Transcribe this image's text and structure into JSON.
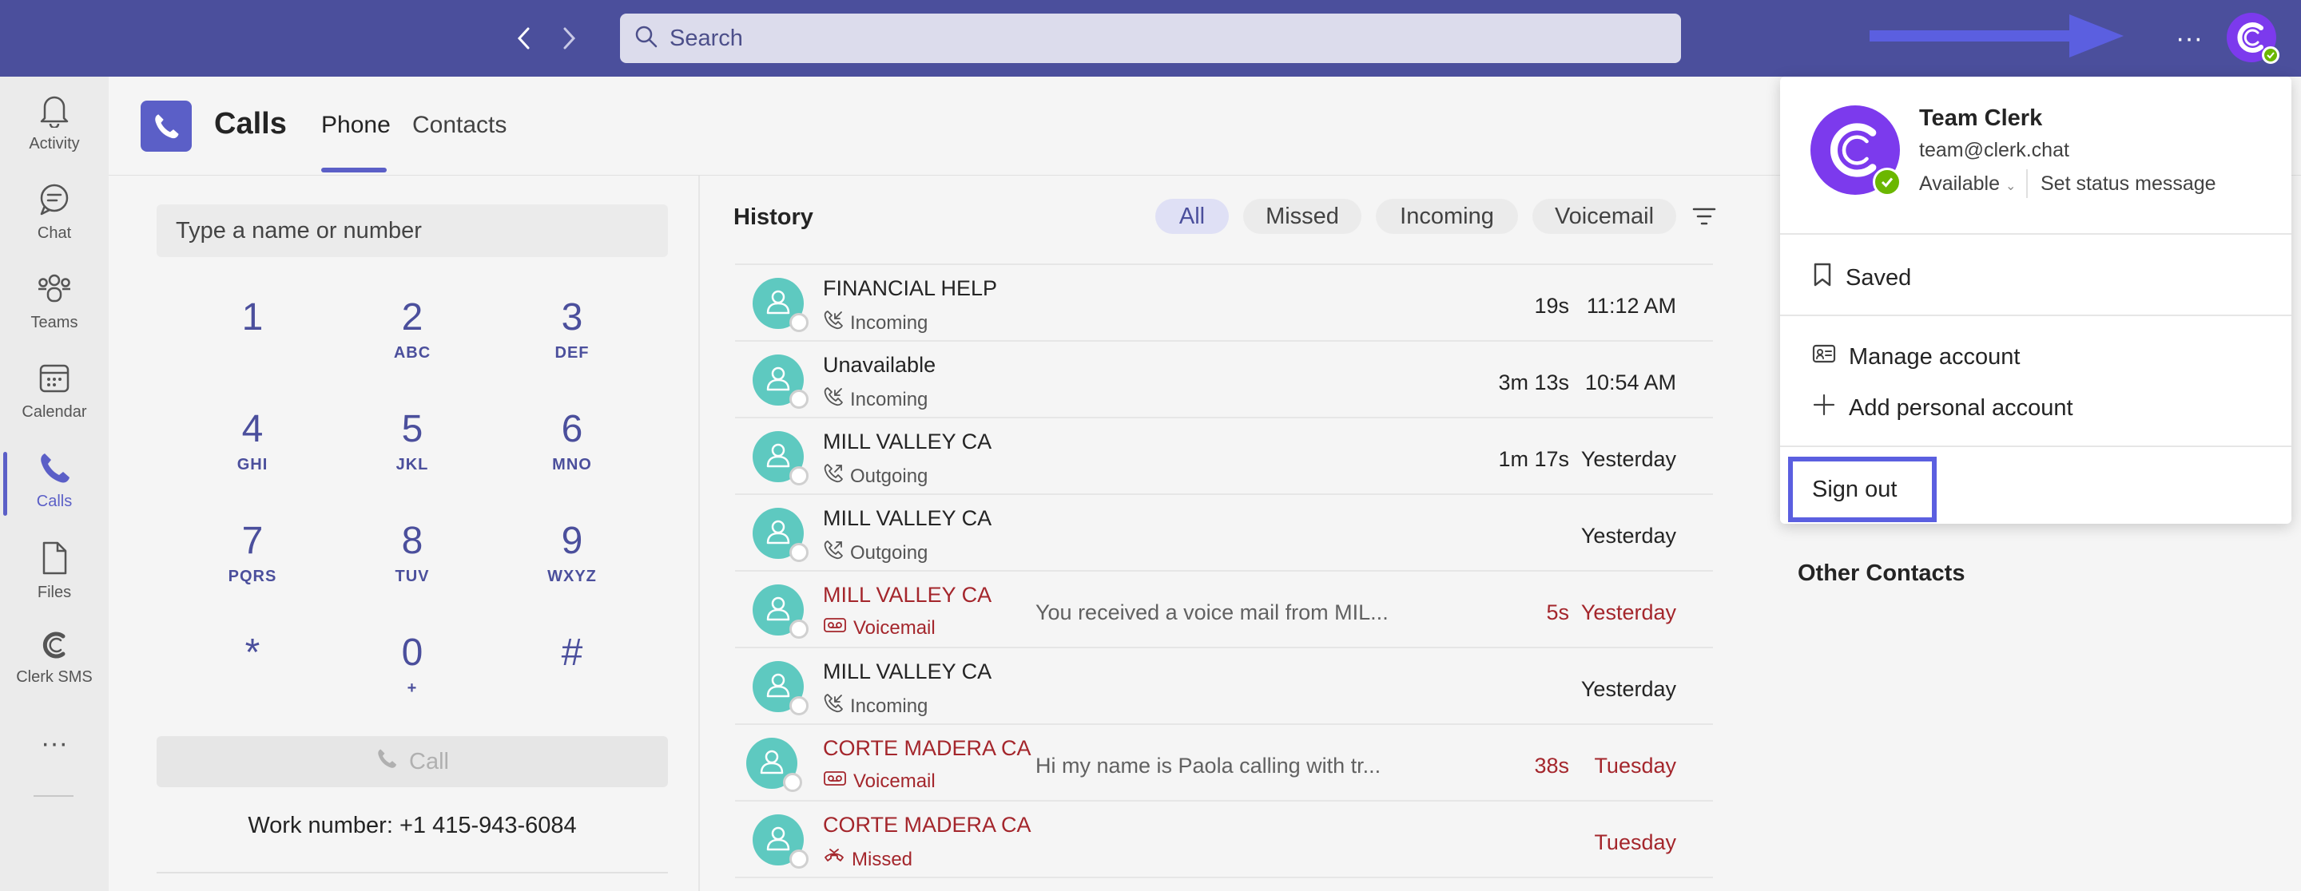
{
  "search": {
    "placeholder": "Search"
  },
  "rail": {
    "items": [
      {
        "label": "Activity",
        "icon": "bell-icon"
      },
      {
        "label": "Chat",
        "icon": "chat-icon"
      },
      {
        "label": "Teams",
        "icon": "teams-icon"
      },
      {
        "label": "Calendar",
        "icon": "calendar-icon"
      },
      {
        "label": "Calls",
        "icon": "phone-icon",
        "active": true
      },
      {
        "label": "Files",
        "icon": "file-icon"
      },
      {
        "label": "Clerk SMS",
        "icon": "clerk-icon"
      }
    ],
    "more": "···"
  },
  "header": {
    "title": "Calls",
    "tabs": [
      {
        "label": "Phone",
        "active": true
      },
      {
        "label": "Contacts"
      }
    ]
  },
  "dialpad": {
    "input_placeholder": "Type a name or number",
    "keys": [
      {
        "num": "1",
        "sub": ""
      },
      {
        "num": "2",
        "sub": "ABC"
      },
      {
        "num": "3",
        "sub": "DEF"
      },
      {
        "num": "4",
        "sub": "GHI"
      },
      {
        "num": "5",
        "sub": "JKL"
      },
      {
        "num": "6",
        "sub": "MNO"
      },
      {
        "num": "7",
        "sub": "PQRS"
      },
      {
        "num": "8",
        "sub": "TUV"
      },
      {
        "num": "9",
        "sub": "WXYZ"
      },
      {
        "num": "*",
        "sub": ""
      },
      {
        "num": "0",
        "sub": "+"
      },
      {
        "num": "#",
        "sub": ""
      }
    ],
    "call_label": "Call",
    "work_number": "Work number: +1 415-943-6084"
  },
  "history": {
    "title": "History",
    "filters": [
      {
        "label": "All",
        "active": true
      },
      {
        "label": "Missed"
      },
      {
        "label": "Incoming"
      },
      {
        "label": "Voicemail"
      }
    ],
    "rows": [
      {
        "name": "FINANCIAL HELP",
        "kind": "Incoming",
        "kind_icon": "incoming-call-icon",
        "snippet": "",
        "duration": "19s",
        "time": "11:12 AM",
        "red": false
      },
      {
        "name": "Unavailable",
        "kind": "Incoming",
        "kind_icon": "incoming-call-icon",
        "snippet": "",
        "duration": "3m 13s",
        "time": "10:54 AM",
        "red": false
      },
      {
        "name": "MILL VALLEY CA",
        "kind": "Outgoing",
        "kind_icon": "outgoing-call-icon",
        "snippet": "",
        "duration": "1m 17s",
        "time": "Yesterday",
        "red": false
      },
      {
        "name": "MILL VALLEY CA",
        "kind": "Outgoing",
        "kind_icon": "outgoing-call-icon",
        "snippet": "",
        "duration": "",
        "time": "Yesterday",
        "red": false
      },
      {
        "name": "MILL VALLEY CA",
        "kind": "Voicemail",
        "kind_icon": "voicemail-icon",
        "snippet": "You received a voice mail from MIL...",
        "duration": "5s",
        "time": "Yesterday",
        "red": true
      },
      {
        "name": "MILL VALLEY CA",
        "kind": "Incoming",
        "kind_icon": "incoming-call-icon",
        "snippet": "",
        "duration": "",
        "time": "Yesterday",
        "red": false
      },
      {
        "name": "CORTE MADERA CA",
        "kind": "Voicemail",
        "kind_icon": "voicemail-icon",
        "snippet": "Hi my name is Paola calling with tr...",
        "duration": "38s",
        "time": "Tuesday",
        "red": true
      },
      {
        "name": "CORTE MADERA CA",
        "kind": "Missed",
        "kind_icon": "missed-call-icon",
        "snippet": "",
        "duration": "",
        "time": "Tuesday",
        "red": true
      }
    ]
  },
  "right_pane": {
    "other_contacts": "Other Contacts"
  },
  "profile_menu": {
    "name": "Team Clerk",
    "email": "team@clerk.chat",
    "availability": "Available",
    "availability_caret": "⌄",
    "set_status": "Set status message",
    "saved": "Saved",
    "manage_account": "Manage account",
    "add_personal_account": "Add personal account",
    "sign_out": "Sign out"
  },
  "colors": {
    "topbar": "#4b4f9c",
    "accent": "#5b5fc7",
    "missed_red": "#a4262c",
    "avatar_teal": "#5ec9c0",
    "brand_purple": "#7c3aed",
    "highlight_box": "#5b5fe0"
  }
}
